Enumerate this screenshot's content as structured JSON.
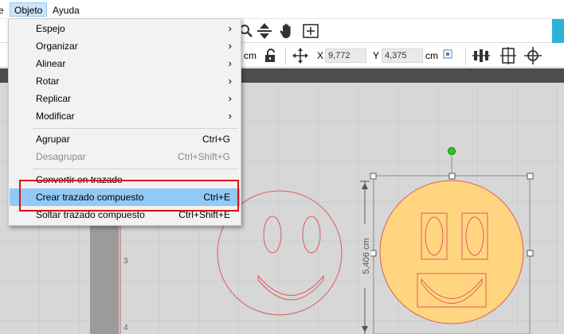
{
  "menubar": {
    "prev_label": "e",
    "objeto_label": "Objeto",
    "ayuda_label": "Ayuda"
  },
  "toolbar": {
    "icons": [
      "zoom-icon",
      "move-down-icon",
      "pan-hand-icon",
      "fit-page-icon"
    ],
    "unit_left": "cm",
    "lock_icon": "lock-icon",
    "move_icon": "move-arrows-icon",
    "x_label": "X",
    "x_value": "9,772",
    "y_label": "Y",
    "y_value": "4,375",
    "unit_right": "cm",
    "right_icons": [
      "align-distribute-icon",
      "align-center-icon",
      "crosshair-icon"
    ]
  },
  "menu": {
    "items": [
      {
        "label": "Espejo",
        "submenu": true
      },
      {
        "label": "Organizar",
        "submenu": true
      },
      {
        "label": "Alinear",
        "submenu": true
      },
      {
        "label": "Rotar",
        "submenu": true
      },
      {
        "label": "Replicar",
        "submenu": true
      },
      {
        "label": "Modificar",
        "submenu": true
      },
      {
        "label": "Agrupar",
        "shortcut": "Ctrl+G"
      },
      {
        "label": "Desagrupar",
        "shortcut": "Ctrl+Shift+G",
        "disabled": true
      },
      {
        "label": "Convertir en trazado"
      },
      {
        "label": "Crear trazado compuesto",
        "shortcut": "Ctrl+E",
        "highlighted": true
      },
      {
        "label": "Soltar trazado compuesto",
        "shortcut": "Ctrl+Shift+E"
      }
    ]
  },
  "canvas": {
    "ruler_labels": [
      "3",
      "4"
    ],
    "dimension_label": "5,406 cm",
    "colors": {
      "grid_bg": "#d7d7d7",
      "grid_line": "#c3c3c3",
      "cut_line": "#e05a5a",
      "fill": "#ffd580",
      "handle": "#ffffff",
      "rotate_handle": "#22cc22",
      "focus_border": "#e01010",
      "highlight": "#91c9f7",
      "accent": "#29b6d6"
    }
  }
}
